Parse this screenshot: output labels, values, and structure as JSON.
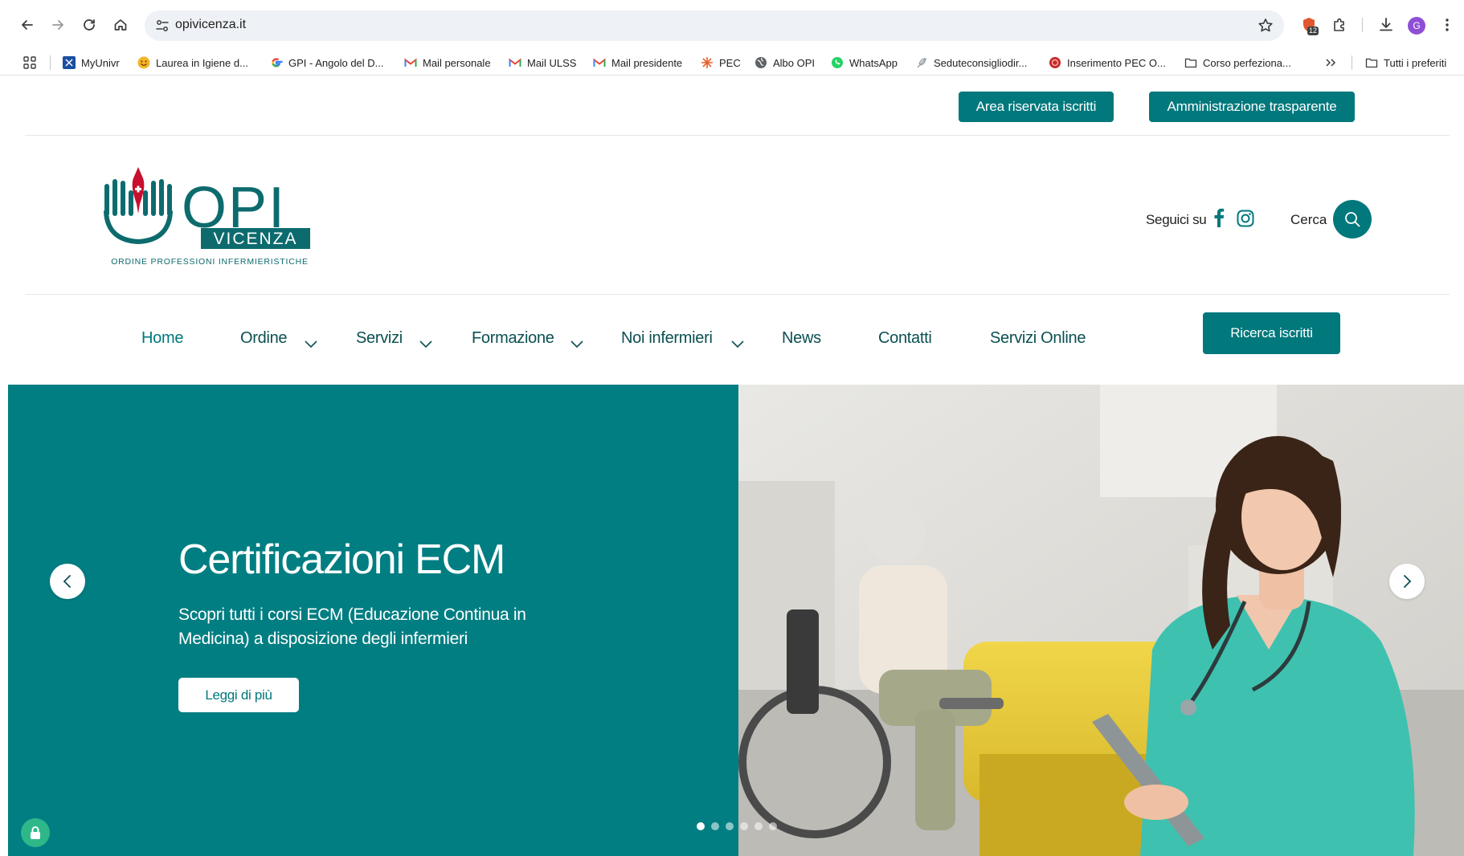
{
  "browser": {
    "url": "opivicenza.it",
    "extension_badge": "12",
    "profile_initial": "G"
  },
  "bookmarks": [
    {
      "label": "MyUnivr",
      "icon": "univr-icon"
    },
    {
      "label": "Laurea in Igiene d...",
      "icon": "emoji-icon"
    },
    {
      "label": "GPI - Angolo del D...",
      "icon": "google-icon"
    },
    {
      "label": "Mail personale",
      "icon": "gmail-icon"
    },
    {
      "label": "Mail ULSS",
      "icon": "gmail-icon"
    },
    {
      "label": "Mail presidente",
      "icon": "gmail-icon"
    },
    {
      "label": "PEC",
      "icon": "spark-icon"
    },
    {
      "label": "Albo OPI",
      "icon": "globe-icon"
    },
    {
      "label": "WhatsApp",
      "icon": "whatsapp-icon"
    },
    {
      "label": "Seduteconsigliodir...",
      "icon": "feather-icon"
    },
    {
      "label": "Inserimento PEC O...",
      "icon": "red-circle-icon"
    },
    {
      "label": "Corso perfeziona...",
      "icon": "folder-icon"
    }
  ],
  "bookmarks_all": "Tutti i preferiti",
  "top_buttons": {
    "area": "Area riservata iscritti",
    "trasparenza": "Amministrazione trasparente"
  },
  "logo": {
    "name": "OPI",
    "city": "VICENZA",
    "tagline": "ORDINE PROFESSIONI INFERMIERISTICHE"
  },
  "social": {
    "label": "Seguici su",
    "search_label": "Cerca"
  },
  "menu": [
    {
      "label": "Home",
      "dropdown": false,
      "active": true
    },
    {
      "label": "Ordine",
      "dropdown": true
    },
    {
      "label": "Servizi",
      "dropdown": true
    },
    {
      "label": "Formazione",
      "dropdown": true
    },
    {
      "label": "Noi infermieri",
      "dropdown": true
    },
    {
      "label": "News",
      "dropdown": false
    },
    {
      "label": "Contatti",
      "dropdown": false
    },
    {
      "label": "Servizi Online",
      "dropdown": false
    }
  ],
  "search_members": "Ricerca iscritti",
  "hero": {
    "title": "Certificazioni ECM",
    "description": "Scopri tutti i corsi ECM (Educazione Continua in Medicina) a disposizione degli infermieri",
    "button": "Leggi di più",
    "slides_total": 6,
    "slide_active": 1
  },
  "colors": {
    "teal": "#00787c",
    "hero_bg": "#007e82",
    "menu_text": "#0b4f52"
  }
}
